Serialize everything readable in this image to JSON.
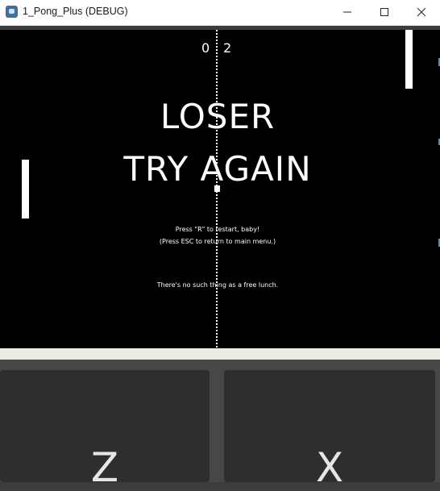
{
  "window": {
    "title": "1_Pong_Plus (DEBUG)"
  },
  "game": {
    "score_left": "0",
    "score_right": "2",
    "headline_1": "LOSER",
    "headline_2": "TRY AGAIN",
    "instruction_1": "Press \"R\" to restart, baby!",
    "instruction_2": "(Press ESC to return to main menu.)",
    "quote": "There's no such thing as a free lunch."
  },
  "controls": {
    "left_key": "Z",
    "right_key": "X"
  },
  "colors": {
    "background": "#000000",
    "foreground": "#ffffff",
    "panel": "#2e2e2e",
    "band": "#ecece4"
  }
}
